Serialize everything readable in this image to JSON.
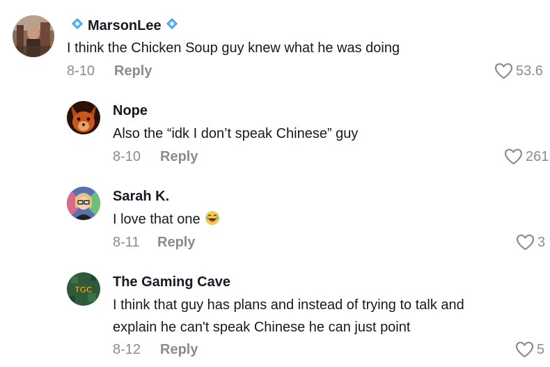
{
  "comments": [
    {
      "username": "MarsonLee",
      "text": "I think the Chicken Soup guy knew what he was doing",
      "date": "8-10",
      "reply_label": "Reply",
      "likes": "53.6"
    },
    {
      "username": "Nope",
      "text": "Also the “idk I don’t speak Chinese” guy",
      "date": "8-10",
      "reply_label": "Reply",
      "likes": "261"
    },
    {
      "username": "Sarah K.",
      "text": "I love that one",
      "date": "8-11",
      "reply_label": "Reply",
      "likes": "3"
    },
    {
      "username": "The Gaming Cave",
      "text_line1": "I think that guy has plans and instead of trying to talk and",
      "text_line2": "explain he can't speak Chinese he can just point",
      "date": "8-12",
      "reply_label": "Reply",
      "likes": "5"
    }
  ],
  "avatar_badge_text": "TGC",
  "icons": {
    "like": "heart-outline-icon",
    "verified": "diamond-icon",
    "emoji": "laughing-face-emoji"
  },
  "colors": {
    "text_primary": "#161823",
    "text_secondary": "#8a8b91",
    "diamond": "#3fa0e8"
  }
}
